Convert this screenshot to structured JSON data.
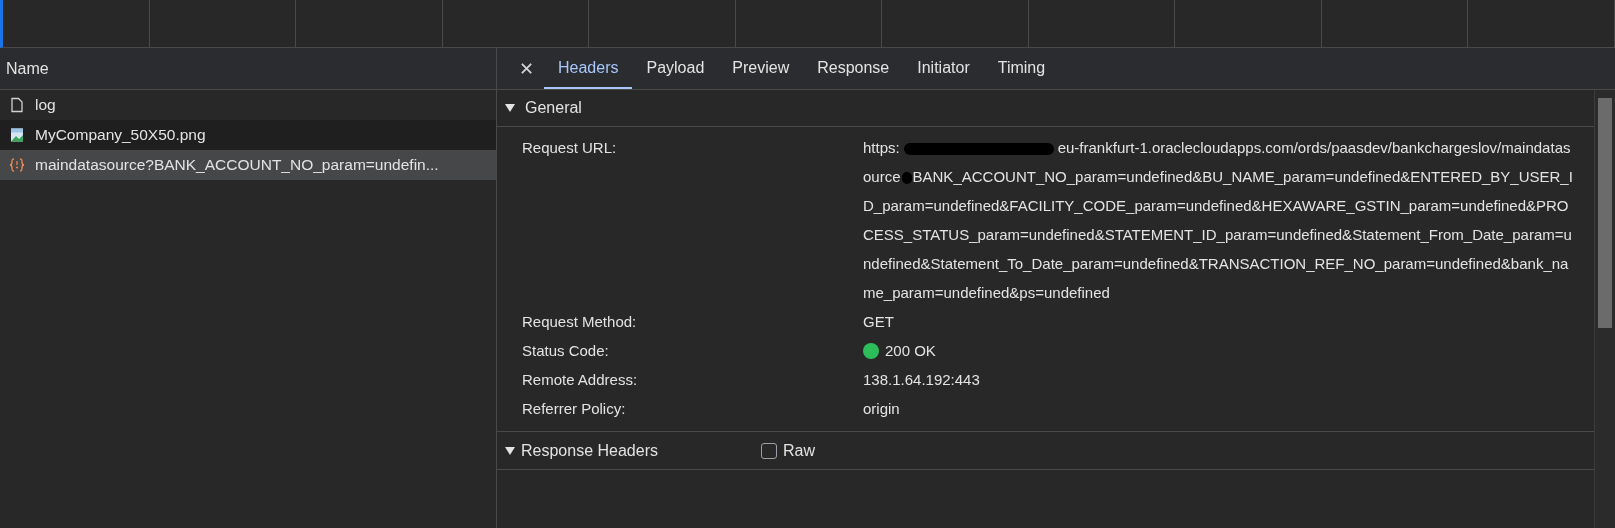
{
  "requests": {
    "header": "Name",
    "items": [
      {
        "kind": "document",
        "name": "log",
        "selected": false
      },
      {
        "kind": "image",
        "name": "MyCompany_50X50.png",
        "selected": false
      },
      {
        "kind": "script",
        "name": "maindatasource?BANK_ACCOUNT_NO_param=undefin...",
        "selected": true
      }
    ]
  },
  "details": {
    "close": "✕",
    "tabs": [
      {
        "label": "Headers",
        "selected": true
      },
      {
        "label": "Payload",
        "selected": false
      },
      {
        "label": "Preview",
        "selected": false
      },
      {
        "label": "Response",
        "selected": false
      },
      {
        "label": "Initiator",
        "selected": false
      },
      {
        "label": "Timing",
        "selected": false
      }
    ],
    "general": {
      "title": "General",
      "expanded": true,
      "rows": [
        {
          "label": "Request URL:",
          "parts": [
            {
              "kind": "text",
              "text": "https:"
            },
            {
              "kind": "redaction"
            },
            {
              "kind": "text",
              "text": "eu-frankfurt-1.oraclecloudapps.com/ords/paasdev/bankchargeslov/maindatasource"
            },
            {
              "kind": "redaction"
            },
            {
              "kind": "text",
              "text": "BANK_ACCOUNT_NO_param=undefined&BU_NAME_param=undefined&ENTERED_BY_USER_ID_param=undefined&FACILITY_CODE_param=undefined&HEXAWARE_GSTIN_param=undefined&PROCESS_STATUS_param=undefined&STATEMENT_ID_param=undefined&Statement_From_Date_param=undefined&Statement_To_Date_param=undefined&TRANSACTION_REF_NO_param=undefined&bank_name_param=undefined&ps=undefined"
            }
          ]
        },
        {
          "label": "Request Method:",
          "value": "GET"
        },
        {
          "label": "Status Code:",
          "value": "200 OK",
          "color": "#2dbe5c"
        },
        {
          "label": "Remote Address:",
          "value": "138.1.64.192:443"
        },
        {
          "label": "Referrer Policy:",
          "value": "origin"
        }
      ]
    },
    "response_headers": {
      "title": "Response Headers",
      "expanded": true,
      "raw": {
        "label": "Raw",
        "checked": false
      }
    }
  }
}
